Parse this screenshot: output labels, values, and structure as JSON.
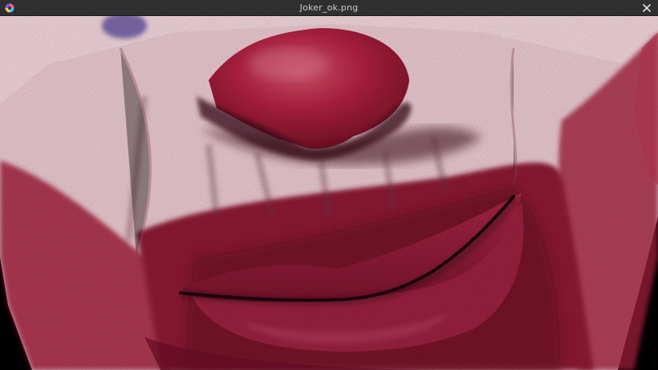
{
  "window": {
    "title": "Joker_ok.png",
    "app_icon": "viewer-app-icon",
    "close_icon": "close-icon"
  },
  "image": {
    "subject": "joker-painting",
    "colors": {
      "skin": "#ead3d8",
      "paint_red": "#a3243f",
      "deep_red": "#5a0f22",
      "nose": "#b32444",
      "background": "#000000"
    }
  }
}
